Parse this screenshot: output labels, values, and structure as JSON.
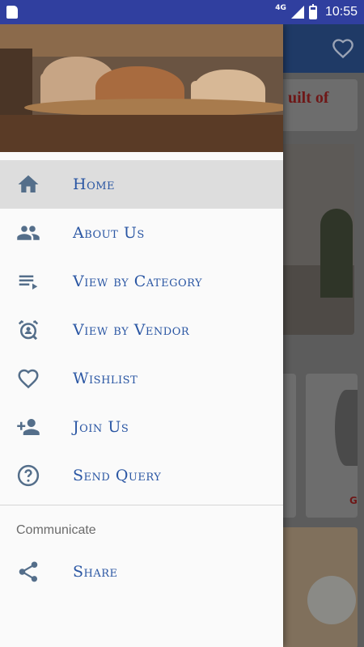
{
  "status_bar": {
    "network": "4G",
    "time": "10:55"
  },
  "background_app": {
    "card_text_1": "uilt of",
    "card_text_2": "G"
  },
  "drawer": {
    "menu": [
      {
        "label": "Home",
        "icon": "home-icon",
        "active": true
      },
      {
        "label": "About Us",
        "icon": "people-icon"
      },
      {
        "label": "View by Category",
        "icon": "category-list-icon"
      },
      {
        "label": "View by Vendor",
        "icon": "vendor-icon"
      },
      {
        "label": "Wishlist",
        "icon": "heart-icon"
      },
      {
        "label": "Join Us",
        "icon": "add-person-icon"
      },
      {
        "label": "Send Query",
        "icon": "help-circle-icon"
      }
    ],
    "section_title": "Communicate",
    "communicate": [
      {
        "label": "Share",
        "icon": "share-icon"
      }
    ]
  },
  "colors": {
    "status_bar": "#303f9f",
    "menu_text": "#2a56a3",
    "icon": "#546e8a",
    "active_row": "#dddddd"
  }
}
